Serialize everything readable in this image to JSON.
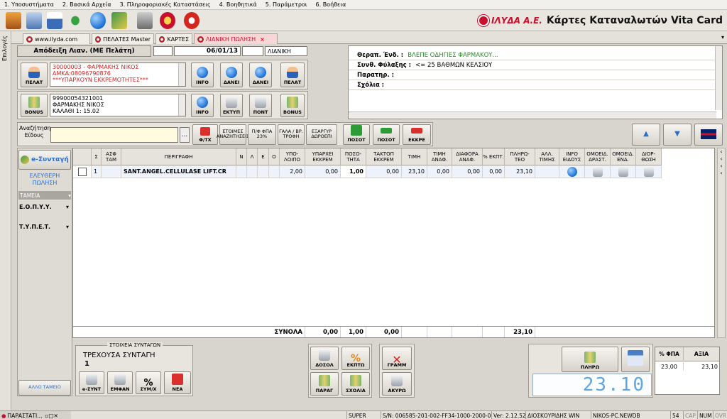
{
  "menu": [
    "1. Υποσυστήματα",
    "2. Βασικά Αρχεία",
    "3. Πληροφοριακές Καταστάσεις",
    "4. Βοηθητικά",
    "5. Παράμετροι",
    "6. Βοήθεια"
  ],
  "brand": {
    "logo": "ΙΛΥΔΑ Α.Ε.",
    "title": "Κάρτες Καταναλωτών Vita Card"
  },
  "side_label": "Επιλογές",
  "tabs": [
    "www.ilyda.com",
    "ΠΕΛΑΤΕΣ Master",
    "ΚΑΡΤΕΣ",
    "ΛΙΑΝΙΚΗ ΠΩΛΗΣΗ"
  ],
  "header": {
    "doc_label": "Απόδειξη Λιαν. (ΜΕ Πελάτη)",
    "date": "06/01/13",
    "type": "ΛΙΑΝΙΚΗ"
  },
  "customer": {
    "lines": [
      "30000003 - ΦΑΡΜΑΚΗΣ ΝΙΚΟΣ",
      "ΑΜΚΑ:08096790876",
      "***ΥΠΑΡΧΟΥΝ ΕΚΚΡΕΜΟΤΗΤΕΣ***"
    ],
    "btn": "ΠΕΛΑΤ",
    "actions": [
      "INFO",
      "ΔΑΝΕΙ",
      "ΔΑΝΕΙ",
      "ΠΕΛΑΤ"
    ]
  },
  "bonus": {
    "lines": [
      "99900054321001",
      "ΦΑΡΜΑΚΗΣ ΝΙΚΟΣ",
      "ΚΑΛΑΘΙ 1: 15.02"
    ],
    "btn": "BONUS",
    "actions": [
      "INFO",
      "ΕΚΤΥΠ",
      "ΠΟΝΤ",
      "BONUS"
    ]
  },
  "info": [
    {
      "k": "Θεραπ. Ένδ. :",
      "v": "ΒΛΕΠΕ ΟΔΗΓΙΕΣ ΦΑΡΜΑΚΟΥ..."
    },
    {
      "k": "Συνθ. Φύλαξης :",
      "v": "<= 25 ΒΑΘΜΩΝ ΚΕΛΣΙΟΥ"
    },
    {
      "k": "Παρατηρ. :",
      "v": ""
    },
    {
      "k": "Σχόλια :",
      "v": ""
    }
  ],
  "search": {
    "label": "Αναζήτηση Είδους",
    "value": "",
    "btn_ellipsis": "...",
    "btns": [
      "Φ/ΤΧ",
      "ΕΤΟΙΜΕΣ ΑΝΑΖΗΤΗΣΕΙΣ",
      "Π/Φ ΦΠΑ 23%",
      "ΓΑΛΑ / ΒΡ. ΤΡΟΦΗ",
      "ΕΞΑΡΓΥΡ ΔΩΡΟΕΠΙ"
    ],
    "qty_btns": [
      "ΠΟΣΟΤ",
      "ΠΟΣΟΤ",
      "ΕΚΚΡΕ"
    ]
  },
  "left": {
    "esyntagi": "e-Συνταγή",
    "free_sale": "ΕΛΕΥΘΕΡΗ ΠΩΛΗΣΗ",
    "tameia": "ΤΑΜΕΙΑ",
    "funds": [
      "Ε.Ο.Π.Υ.Υ.",
      "Τ.Υ.Π.Ε.Τ."
    ],
    "other": "ΑΛΛΟ ΤΑΜΕΙΟ"
  },
  "columns": [
    "Σ",
    "ΑΣΦ ΤΑΜ",
    "ΠΕΡΙΓΡΑΦΗ",
    "Ν",
    "Λ",
    "Ε",
    "Ο",
    "ΥΠΟ- ΛΟΙΠΟ",
    "ΥΠΑΡΧΕΙ ΕΚΚΡΕΜ",
    "ΠΟΣΟ- ΤΗΤΑ",
    "ΤΑΚΤΟΠ ΕΚΚΡΕΜ",
    "ΤΙΜΗ",
    "ΤΙΜΗ ΑΝΑΦ.",
    "ΔΙΑΦΟΡΑ ΑΝΑΦ.",
    "% ΕΚΠΤ.",
    "ΠΛΗΡΩ- ΤΕΟ",
    "ΑΛΛ. ΤΙΜΗΣ",
    "INFO ΕΙΔΟΥΣ",
    "ΟΜΟΕΙΔ. ΔΡΑΣΤ.",
    "ΟΜΟΕΙΔ. ΕΝΔ.",
    "ΔΙΟΡ- ΘΩΣΗ"
  ],
  "row": {
    "s": "1",
    "desc": "SANT.ANGEL.CELLULASE LIFT.CR",
    "ypoloipo": "2,00",
    "ekkrem": "0,00",
    "qty": "1,00",
    "taktop": "0,00",
    "price": "23,10",
    "ref": "0,00",
    "diff": "0,00",
    "disc": "0,00",
    "pay": "23,10"
  },
  "totals": {
    "label": "ΣΥΝΟΛΑ",
    "ekkrem": "0,00",
    "qty": "1,00",
    "taktop": "0,00",
    "pay": "23,10"
  },
  "prescription": {
    "title": "ΣΤΟΙΧΕΙΑ ΣΥΝΤΑΓΩΝ",
    "current": "ΤΡΕΧΟΥΣΑ ΣΥΝΤΑΓΗ",
    "num": "1",
    "btns": [
      "e-ΣΥΝΤ",
      "ΕΜΦΑΝ",
      "ΣΥΜ/Χ",
      "ΝΕΑ"
    ]
  },
  "mid_btns": [
    "ΔΟΣΟΛ",
    "ΕΚΠΤΩ",
    "ΠΑΡΑΓ",
    "ΣΧΟΛΙΑ"
  ],
  "del_btns": [
    "ΓΡΑΜΜ",
    "ΑΚΥΡΩ"
  ],
  "pay_btn": "ΠΛΗΡΩ",
  "lcd": "23.10",
  "vat": {
    "cols": [
      "% ΦΠΑ",
      "ΑΞΙΑ"
    ],
    "row": [
      "23,00",
      "23,10"
    ]
  },
  "status": {
    "task": "ΠΑΡΑΣΤΑΤΙ...",
    "user": "SUPER",
    "sn": "S/N: 006585-201-002-FF34-1000-2000-000(",
    "ver": "Ver: 2.12.52",
    "admin": "ΔΙΟΣΚΟΥΡΙΔΗΣ WIN",
    "db": "NIKOS-PC.NEWDB",
    "n": "54",
    "caps": "CAP",
    "num": "NUM",
    "ovr": "OVR"
  }
}
